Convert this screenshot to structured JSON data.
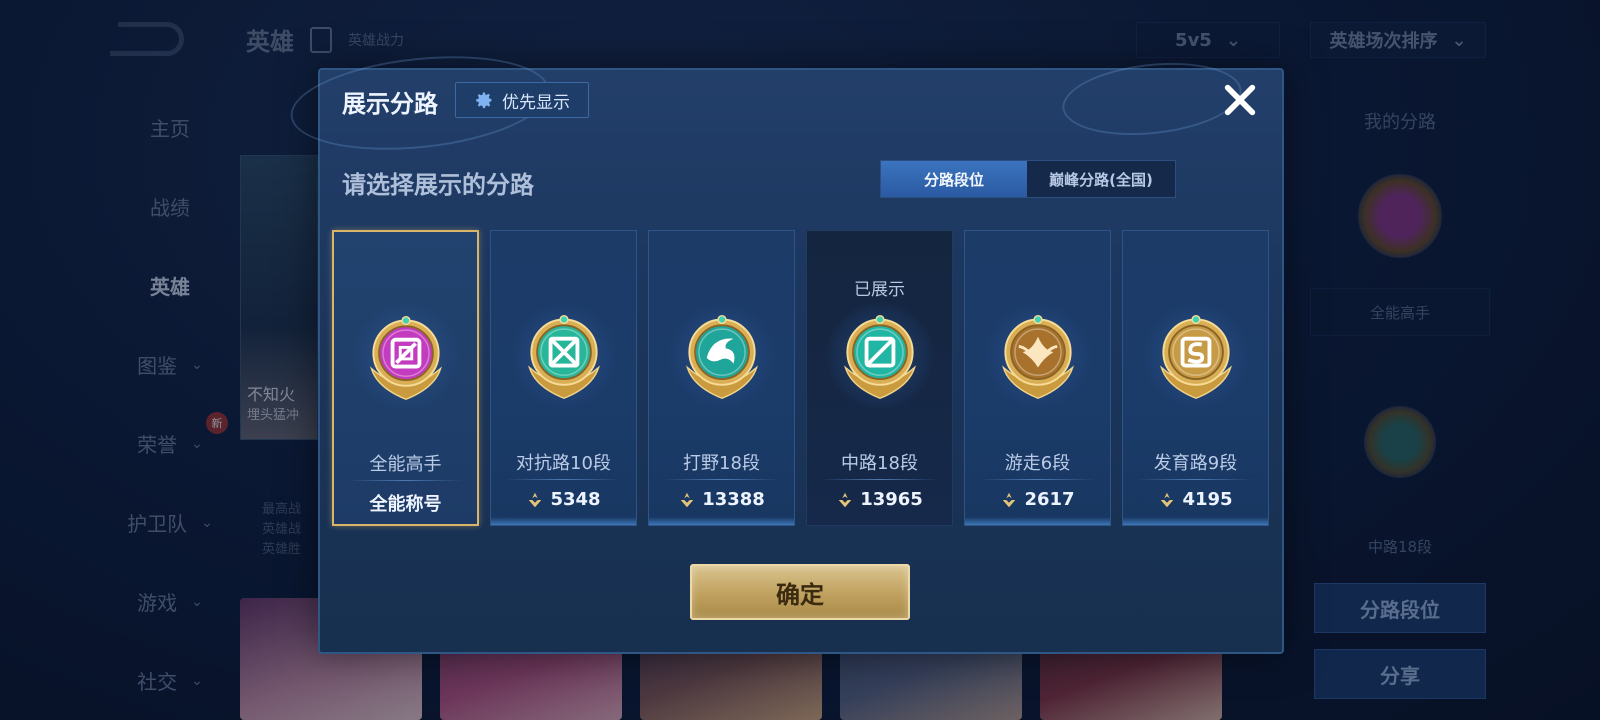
{
  "background": {
    "header": {
      "title": "英雄",
      "subtitle": "英雄战力"
    },
    "mode_select": "5v5",
    "sort_select": "英雄场次排序",
    "sidebar": [
      {
        "label": "主页",
        "chevron": false,
        "active": false
      },
      {
        "label": "战绩",
        "chevron": false,
        "active": false
      },
      {
        "label": "英雄",
        "chevron": false,
        "active": true
      },
      {
        "label": "图鉴",
        "chevron": true,
        "active": false
      },
      {
        "label": "荣誉",
        "chevron": true,
        "active": false,
        "badge": "新"
      },
      {
        "label": "护卫队",
        "chevron": true,
        "active": false
      },
      {
        "label": "游戏",
        "chevron": true,
        "active": false
      },
      {
        "label": "社交",
        "chevron": true,
        "active": false
      }
    ],
    "hero_panel": {
      "name": "不知火",
      "sub": "埋头猛冲"
    },
    "hero_stats": [
      "最高战",
      "英雄战",
      "英雄胜"
    ],
    "right_column": {
      "title": "我的分路",
      "primary_label": "全能高手",
      "secondary_label": "中路18段",
      "lane_rank_button": "分路段位",
      "share_button": "分享"
    }
  },
  "dialog": {
    "title": "展示分路",
    "priority_button": "优先显示",
    "subtitle": "请选择展示的分路",
    "tabs": [
      {
        "label": "分路段位",
        "active": true
      },
      {
        "label": "巅峰分路(全国)",
        "active": false
      }
    ],
    "lanes": [
      {
        "name": "全能高手",
        "score": "",
        "title_label": "全能称号",
        "state": "selected",
        "medal": "allround",
        "color": "#c33bbf"
      },
      {
        "name": "对抗路10段",
        "score": "5348",
        "state": "normal",
        "medal": "clash",
        "color": "#27b69a"
      },
      {
        "name": "打野18段",
        "score": "13388",
        "state": "normal",
        "medal": "jungle",
        "color": "#1fa59a"
      },
      {
        "name": "中路18段",
        "score": "13965",
        "state": "displayed",
        "shown_tag": "已展示",
        "medal": "mid",
        "color": "#21b5a3"
      },
      {
        "name": "游走6段",
        "score": "2617",
        "state": "normal",
        "medal": "roam",
        "color": "#a8722d"
      },
      {
        "name": "发育路9段",
        "score": "4195",
        "state": "normal",
        "medal": "farm",
        "color": "#c79a45"
      }
    ],
    "confirm_button": "确定"
  },
  "colors": {
    "accent_gold": "#d8c38e",
    "tab_active": "#3c74bf",
    "dialog_bg": "#1b355c"
  }
}
